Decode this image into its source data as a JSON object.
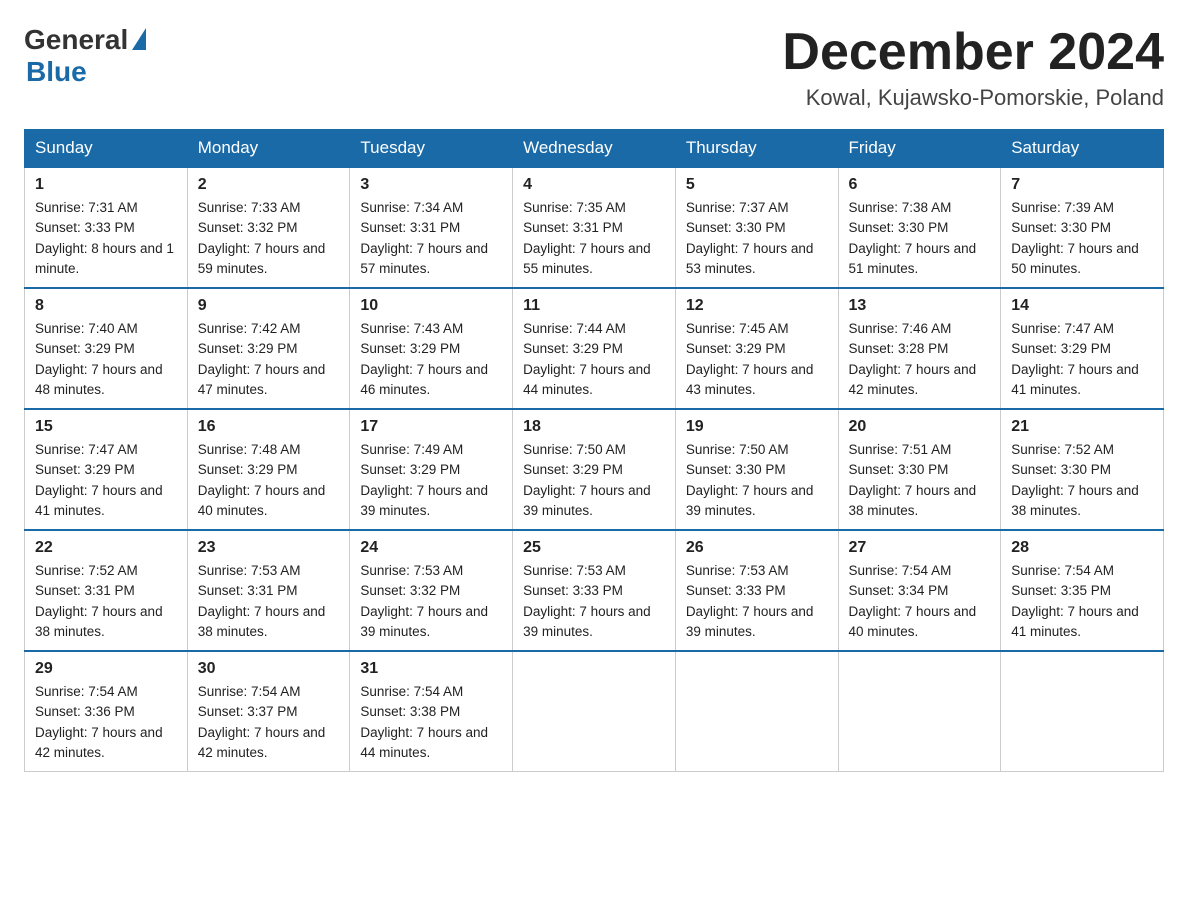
{
  "header": {
    "logo_general": "General",
    "logo_blue": "Blue",
    "title": "December 2024",
    "location": "Kowal, Kujawsko-Pomorskie, Poland"
  },
  "days_of_week": [
    "Sunday",
    "Monday",
    "Tuesday",
    "Wednesday",
    "Thursday",
    "Friday",
    "Saturday"
  ],
  "weeks": [
    [
      {
        "day": "1",
        "sunrise": "7:31 AM",
        "sunset": "3:33 PM",
        "daylight": "8 hours and 1 minute."
      },
      {
        "day": "2",
        "sunrise": "7:33 AM",
        "sunset": "3:32 PM",
        "daylight": "7 hours and 59 minutes."
      },
      {
        "day": "3",
        "sunrise": "7:34 AM",
        "sunset": "3:31 PM",
        "daylight": "7 hours and 57 minutes."
      },
      {
        "day": "4",
        "sunrise": "7:35 AM",
        "sunset": "3:31 PM",
        "daylight": "7 hours and 55 minutes."
      },
      {
        "day": "5",
        "sunrise": "7:37 AM",
        "sunset": "3:30 PM",
        "daylight": "7 hours and 53 minutes."
      },
      {
        "day": "6",
        "sunrise": "7:38 AM",
        "sunset": "3:30 PM",
        "daylight": "7 hours and 51 minutes."
      },
      {
        "day": "7",
        "sunrise": "7:39 AM",
        "sunset": "3:30 PM",
        "daylight": "7 hours and 50 minutes."
      }
    ],
    [
      {
        "day": "8",
        "sunrise": "7:40 AM",
        "sunset": "3:29 PM",
        "daylight": "7 hours and 48 minutes."
      },
      {
        "day": "9",
        "sunrise": "7:42 AM",
        "sunset": "3:29 PM",
        "daylight": "7 hours and 47 minutes."
      },
      {
        "day": "10",
        "sunrise": "7:43 AM",
        "sunset": "3:29 PM",
        "daylight": "7 hours and 46 minutes."
      },
      {
        "day": "11",
        "sunrise": "7:44 AM",
        "sunset": "3:29 PM",
        "daylight": "7 hours and 44 minutes."
      },
      {
        "day": "12",
        "sunrise": "7:45 AM",
        "sunset": "3:29 PM",
        "daylight": "7 hours and 43 minutes."
      },
      {
        "day": "13",
        "sunrise": "7:46 AM",
        "sunset": "3:28 PM",
        "daylight": "7 hours and 42 minutes."
      },
      {
        "day": "14",
        "sunrise": "7:47 AM",
        "sunset": "3:29 PM",
        "daylight": "7 hours and 41 minutes."
      }
    ],
    [
      {
        "day": "15",
        "sunrise": "7:47 AM",
        "sunset": "3:29 PM",
        "daylight": "7 hours and 41 minutes."
      },
      {
        "day": "16",
        "sunrise": "7:48 AM",
        "sunset": "3:29 PM",
        "daylight": "7 hours and 40 minutes."
      },
      {
        "day": "17",
        "sunrise": "7:49 AM",
        "sunset": "3:29 PM",
        "daylight": "7 hours and 39 minutes."
      },
      {
        "day": "18",
        "sunrise": "7:50 AM",
        "sunset": "3:29 PM",
        "daylight": "7 hours and 39 minutes."
      },
      {
        "day": "19",
        "sunrise": "7:50 AM",
        "sunset": "3:30 PM",
        "daylight": "7 hours and 39 minutes."
      },
      {
        "day": "20",
        "sunrise": "7:51 AM",
        "sunset": "3:30 PM",
        "daylight": "7 hours and 38 minutes."
      },
      {
        "day": "21",
        "sunrise": "7:52 AM",
        "sunset": "3:30 PM",
        "daylight": "7 hours and 38 minutes."
      }
    ],
    [
      {
        "day": "22",
        "sunrise": "7:52 AM",
        "sunset": "3:31 PM",
        "daylight": "7 hours and 38 minutes."
      },
      {
        "day": "23",
        "sunrise": "7:53 AM",
        "sunset": "3:31 PM",
        "daylight": "7 hours and 38 minutes."
      },
      {
        "day": "24",
        "sunrise": "7:53 AM",
        "sunset": "3:32 PM",
        "daylight": "7 hours and 39 minutes."
      },
      {
        "day": "25",
        "sunrise": "7:53 AM",
        "sunset": "3:33 PM",
        "daylight": "7 hours and 39 minutes."
      },
      {
        "day": "26",
        "sunrise": "7:53 AM",
        "sunset": "3:33 PM",
        "daylight": "7 hours and 39 minutes."
      },
      {
        "day": "27",
        "sunrise": "7:54 AM",
        "sunset": "3:34 PM",
        "daylight": "7 hours and 40 minutes."
      },
      {
        "day": "28",
        "sunrise": "7:54 AM",
        "sunset": "3:35 PM",
        "daylight": "7 hours and 41 minutes."
      }
    ],
    [
      {
        "day": "29",
        "sunrise": "7:54 AM",
        "sunset": "3:36 PM",
        "daylight": "7 hours and 42 minutes."
      },
      {
        "day": "30",
        "sunrise": "7:54 AM",
        "sunset": "3:37 PM",
        "daylight": "7 hours and 42 minutes."
      },
      {
        "day": "31",
        "sunrise": "7:54 AM",
        "sunset": "3:38 PM",
        "daylight": "7 hours and 44 minutes."
      },
      null,
      null,
      null,
      null
    ]
  ],
  "labels": {
    "sunrise": "Sunrise:",
    "sunset": "Sunset:",
    "daylight": "Daylight:"
  }
}
